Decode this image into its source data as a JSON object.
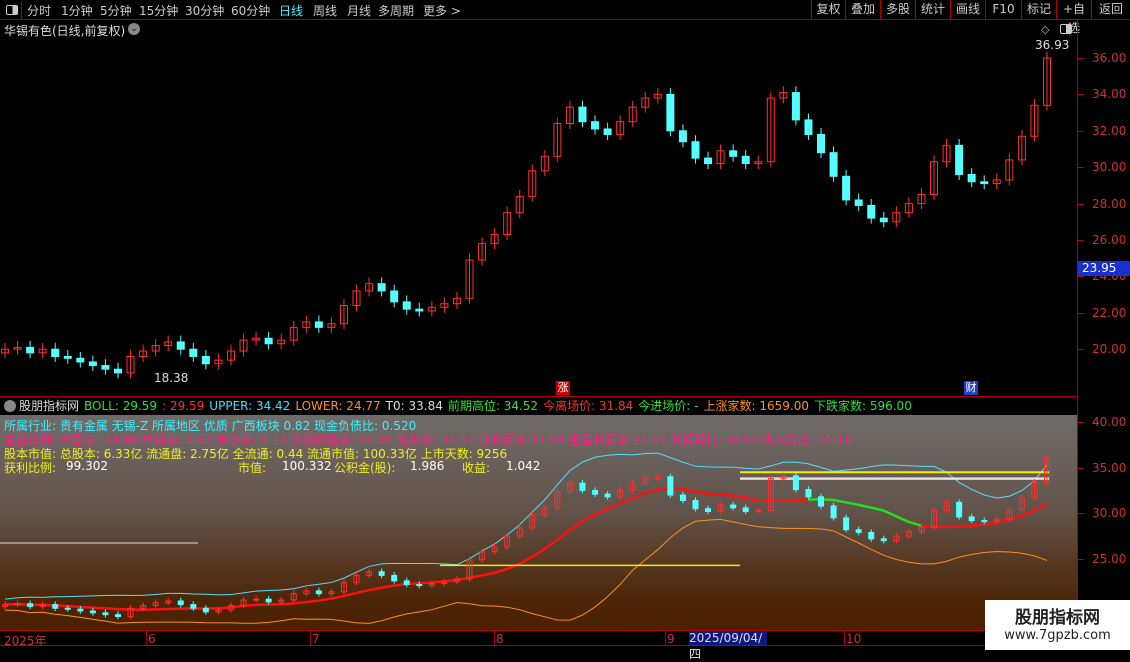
{
  "toolbar": {
    "periods": [
      "分时",
      "1分钟",
      "5分钟",
      "15分钟",
      "30分钟",
      "60分钟",
      "日线",
      "周线",
      "月线",
      "多周期",
      "更多 >"
    ],
    "active": "日线",
    "buttons": [
      "复权",
      "叠加",
      "多股",
      "统计",
      "画线",
      "F10",
      "标记",
      "+自选",
      "返回"
    ]
  },
  "stock": {
    "title": "华锡有色(日线,前复权)",
    "high_label": "36.93",
    "low_label": "18.38",
    "current_price": "23.95",
    "marker_zhang": "涨",
    "marker_cai": "财"
  },
  "main_axis": [
    "36.00",
    "34.00",
    "32.00",
    "30.00",
    "28.00",
    "26.00",
    "24.00",
    "22.00",
    "20.00"
  ],
  "closes": [
    20.0,
    20.1,
    19.8,
    20.0,
    19.6,
    19.5,
    19.3,
    19.1,
    18.9,
    18.7,
    19.6,
    19.9,
    20.2,
    20.4,
    20.0,
    19.6,
    19.2,
    19.4,
    19.9,
    20.5,
    20.6,
    20.3,
    20.5,
    21.2,
    21.5,
    21.2,
    21.4,
    22.4,
    23.2,
    23.6,
    23.2,
    22.6,
    22.2,
    22.1,
    22.3,
    22.5,
    22.8,
    24.9,
    25.8,
    26.3,
    27.5,
    28.4,
    29.8,
    30.6,
    32.4,
    33.3,
    32.5,
    32.1,
    31.8,
    32.5,
    33.3,
    33.8,
    34.0,
    32.0,
    31.4,
    30.5,
    30.2,
    30.9,
    30.6,
    30.2,
    30.3,
    33.8,
    34.1,
    32.6,
    31.8,
    30.8,
    29.5,
    28.2,
    27.9,
    27.2,
    27.0,
    27.5,
    28.0,
    28.5,
    30.3,
    31.2,
    29.6,
    29.2,
    29.1,
    29.3,
    30.4,
    31.7,
    33.4,
    36.0
  ],
  "indicator": {
    "name": "股朋指标网",
    "boll": "BOLL: 29.59",
    "boll2": ": 29.59",
    "upper": "UPPER: 34.42",
    "lower": "LOWER: 24.77",
    "t0": "T0: 33.84",
    "prev_high": "前期高位: 34.52",
    "exit": "今离场价: 31.84",
    "entry": "今进场价: -",
    "up_count": "上涨家数: 1659.00",
    "down_count": "下跌家数: 596.00"
  },
  "info": {
    "line1": "所属行业: 贵有金属 无锡-Z 所属地区 优质 广西板块 0.82 现金负债比: 0.520",
    "line2": "主营比例: 市盈率: 34.98 市销率: 5.57 市净率: 5.13 净资收益率: 14.66 毛利率: 34.37 净利润率 11.94 主营利润率 24.07 利润同比: -8.54 收入同比: 21.16",
    "line3": "股本市值: 总股本: 6.33亿 流通盘: 2.75亿 全流通: 0.44 流通市值: 100.33亿 上市天数: 9256",
    "line4a": "获利比例:",
    "line4b": "99.302",
    "line4c": "市值:",
    "line4d": "100.332",
    "line4e": "公积金(股):",
    "line4f": "1.986",
    "line4g": "收益:",
    "line4h": "1.042"
  },
  "lower_axis": [
    "40.00",
    "35.00",
    "30.00",
    "25.00"
  ],
  "time_axis": {
    "labels": [
      "2025年",
      "6",
      "7",
      "8",
      "9",
      "10"
    ],
    "cursor": "2025/09/04/四"
  },
  "watermark": {
    "name": "股朋指标网",
    "url": "www.7gpzb.com"
  },
  "colors": {
    "up": "#ff3030",
    "down": "#54ffff",
    "axis": "#b00000"
  }
}
